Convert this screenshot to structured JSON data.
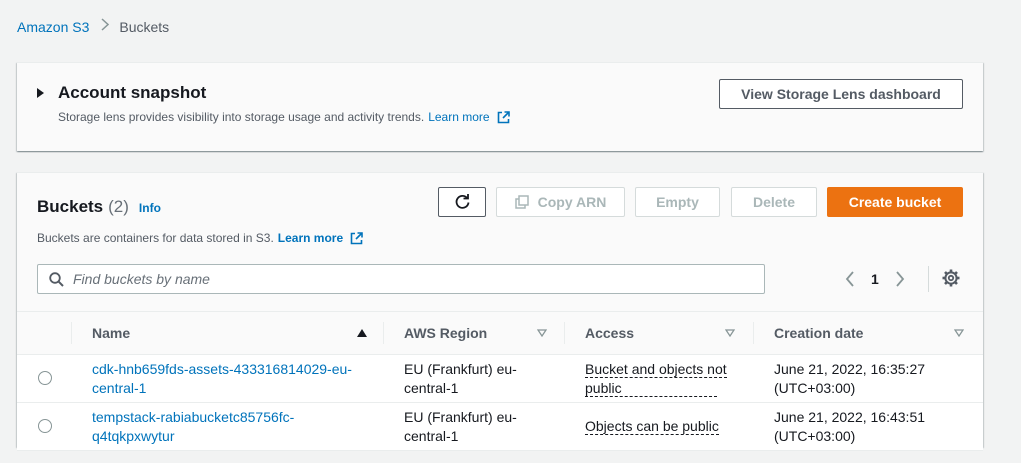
{
  "breadcrumb": {
    "root": "Amazon S3",
    "current": "Buckets"
  },
  "snapshot": {
    "title": "Account snapshot",
    "description": "Storage lens provides visibility into storage usage and activity trends.",
    "learn_more": "Learn more",
    "lens_button": "View Storage Lens dashboard"
  },
  "buckets": {
    "title": "Buckets",
    "count": "(2)",
    "info": "Info",
    "description": "Buckets are containers for data stored in S3.",
    "learn_more": "Learn more",
    "buttons": {
      "copy_arn": "Copy ARN",
      "empty": "Empty",
      "delete": "Delete",
      "create": "Create bucket"
    },
    "search_placeholder": "Find buckets by name",
    "page": "1",
    "columns": {
      "name": "Name",
      "region": "AWS Region",
      "access": "Access",
      "created": "Creation date"
    },
    "rows": [
      {
        "name_1": "cdk-hnb659fds-assets-433316814029-eu-",
        "name_2": "central-1",
        "region_1": "EU (Frankfurt) eu-",
        "region_2": "central-1",
        "access_1": "Bucket and objects not",
        "access_2": "public",
        "created_1": "June 21, 2022, 16:35:27",
        "created_2": "(UTC+03:00)"
      },
      {
        "name_1": "tempstack-rabiabucketc85756fc-",
        "name_2": "q4tqkpxwytur",
        "region_1": "EU (Frankfurt) eu-",
        "region_2": "central-1",
        "access_1": "Objects can be public",
        "access_2": "",
        "created_1": "June 21, 2022, 16:43:51",
        "created_2": "(UTC+03:00)"
      }
    ]
  },
  "colors": {
    "accent": "#ec7211",
    "link": "#0073bb",
    "text": "#16191f",
    "muted": "#545b64"
  }
}
